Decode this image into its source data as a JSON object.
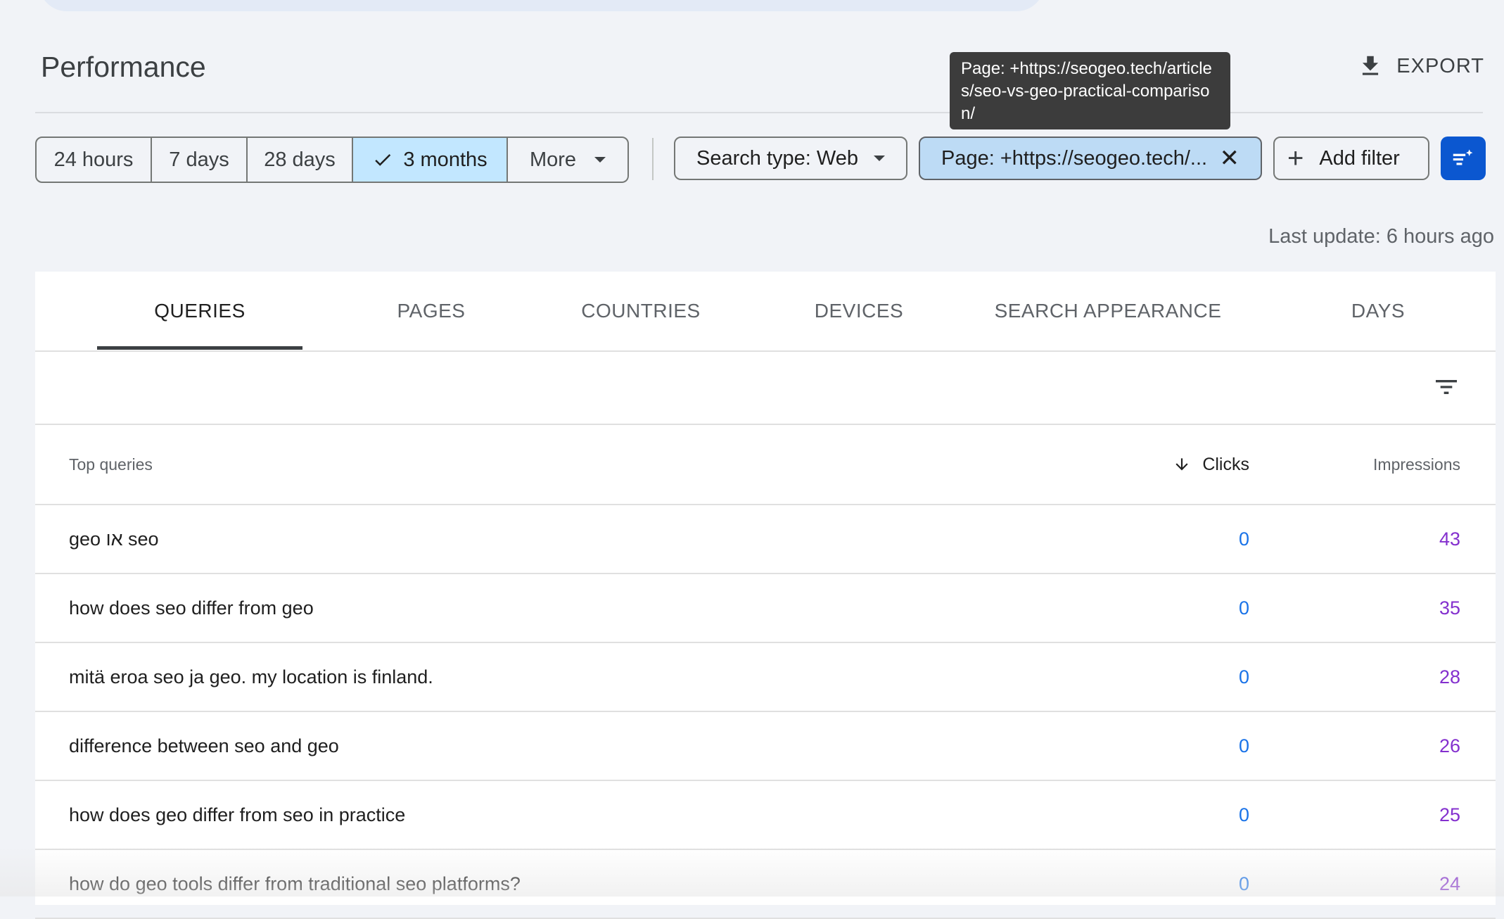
{
  "title": "Performance",
  "export_label": "EXPORT",
  "tooltip": "Page: +https://seogeo.tech/articles/seo-vs-geo-practical-comparison/",
  "date_range": {
    "options": [
      "24 hours",
      "7 days",
      "28 days",
      "3 months",
      "More"
    ],
    "selected": "3 months"
  },
  "filters": {
    "search_type": "Search type: Web",
    "page": "Page: +https://seogeo.tech/...",
    "add_filter": "Add filter"
  },
  "last_update": "Last update: 6 hours ago",
  "tabs": [
    "QUERIES",
    "PAGES",
    "COUNTRIES",
    "DEVICES",
    "SEARCH APPEARANCE",
    "DAYS"
  ],
  "active_tab": "QUERIES",
  "table": {
    "headers": {
      "query": "Top queries",
      "clicks": "Clicks",
      "impressions": "Impressions"
    },
    "rows": [
      {
        "query": "geo או seo",
        "clicks": "0",
        "impressions": "43"
      },
      {
        "query": "how does seo differ from geo",
        "clicks": "0",
        "impressions": "35"
      },
      {
        "query": "mitä eroa seo ja geo. my location is finland.",
        "clicks": "0",
        "impressions": "28"
      },
      {
        "query": "difference between seo and geo",
        "clicks": "0",
        "impressions": "26"
      },
      {
        "query": "how does geo differ from seo in practice",
        "clicks": "0",
        "impressions": "25"
      },
      {
        "query": "how do geo tools differ from traditional seo platforms?",
        "clicks": "0",
        "impressions": "24"
      }
    ]
  },
  "icons": {
    "export": "download-icon",
    "check": "check-icon",
    "dropdown": "caret-down-icon",
    "close": "close-icon",
    "add": "plus-icon",
    "advanced": "filter-sparkle-icon",
    "table_filter": "filter-list-icon",
    "sort": "arrow-down-icon"
  },
  "colors": {
    "selected_chip": "#c2e7ff",
    "page_chip": "#bddbf5",
    "primary_button": "#0b57d0",
    "clicks": "#1a73e8",
    "impressions": "#8430ce"
  }
}
